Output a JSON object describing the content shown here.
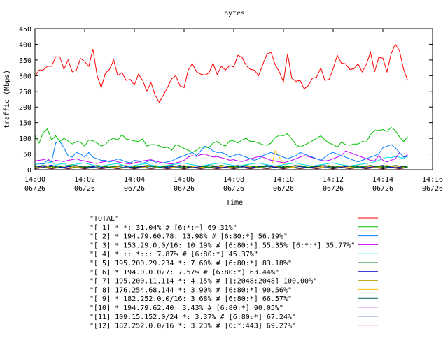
{
  "chart_data": {
    "type": "line",
    "title": "bytes",
    "xlabel": "Time",
    "ylabel": "traffic (Mbps)",
    "ylim": [
      0,
      450
    ],
    "xlim": [
      "14:00",
      "14:16"
    ],
    "grid": false,
    "legend_position": "bottom",
    "yticks": [
      "0",
      "50",
      "100",
      "150",
      "200",
      "250",
      "300",
      "350",
      "400",
      "450"
    ],
    "xticks": [
      {
        "time": "14:00",
        "date": "06/26"
      },
      {
        "time": "14:02",
        "date": "06/26"
      },
      {
        "time": "14:04",
        "date": "06/26"
      },
      {
        "time": "14:06",
        "date": "06/26"
      },
      {
        "time": "14:08",
        "date": "06/26"
      },
      {
        "time": "14:10",
        "date": "06/26"
      },
      {
        "time": "14:12",
        "date": "06/26"
      },
      {
        "time": "14:14",
        "date": "06/26"
      },
      {
        "time": "14:16",
        "date": "06/26"
      }
    ],
    "x_step_seconds": 10,
    "series": [
      {
        "name": "\"TOTAL\"",
        "color": "#ff0000",
        "values": [
          298,
          318,
          318,
          330,
          330,
          360,
          360,
          320,
          350,
          312,
          318,
          355,
          345,
          330,
          385,
          300,
          262,
          308,
          320,
          350,
          300,
          310,
          285,
          288,
          270,
          305,
          285,
          250,
          278,
          238,
          215,
          238,
          262,
          290,
          300,
          268,
          262,
          318,
          338,
          312,
          305,
          302,
          308,
          340,
          304,
          330,
          318,
          332,
          328,
          365,
          358,
          332,
          320,
          318,
          300,
          335,
          368,
          375,
          335,
          312,
          280,
          370,
          292,
          282,
          285,
          258,
          268,
          292,
          295,
          325,
          285,
          288,
          322,
          365,
          340,
          338,
          320,
          322,
          338,
          312,
          335,
          375,
          312,
          358,
          356,
          312,
          370,
          400,
          380,
          320,
          285
        ]
      },
      {
        "name": "\"[ 1] * *: 31.04% # [6:*:*] 69.31%\"",
        "color": "#00c000",
        "values": [
          110,
          85,
          118,
          130,
          95,
          108,
          90,
          100,
          92,
          82,
          90,
          88,
          75,
          95,
          92,
          85,
          75,
          80,
          95,
          100,
          95,
          112,
          98,
          95,
          92,
          90,
          98,
          75,
          80,
          80,
          76,
          70,
          72,
          62,
          80,
          75,
          68,
          62,
          55,
          62,
          72,
          72,
          70,
          85,
          90,
          80,
          75,
          92,
          92,
          85,
          95,
          100,
          90,
          90,
          85,
          80,
          78,
          85,
          102,
          110,
          108,
          115,
          98,
          80,
          72,
          78,
          85,
          92,
          100,
          108,
          95,
          85,
          80,
          72,
          88,
          80,
          78,
          82,
          82,
          90,
          88,
          112,
          125,
          125,
          128,
          122,
          135,
          125,
          105,
          90,
          105
        ]
      },
      {
        "name": "\"[ 2] * 194.79.60.78: 13.98% # [6:80:*] 56.19%\"",
        "color": "#0080ff",
        "values": [
          22,
          20,
          18,
          30,
          25,
          85,
          90,
          70,
          45,
          40,
          55,
          50,
          40,
          55,
          40,
          35,
          30,
          30,
          25,
          28,
          35,
          30,
          25,
          22,
          30,
          28,
          20,
          25,
          30,
          25,
          20,
          22,
          25,
          28,
          35,
          40,
          45,
          50,
          55,
          45,
          60,
          75,
          70,
          60,
          55,
          55,
          50,
          40,
          45,
          50,
          45,
          40,
          35,
          30,
          35,
          45,
          50,
          55,
          50,
          45,
          40,
          35,
          40,
          45,
          55,
          50,
          45,
          40,
          35,
          30,
          40,
          50,
          55,
          50,
          45,
          40,
          35,
          30,
          25,
          30,
          35,
          40,
          45,
          50,
          70,
          75,
          80,
          70,
          55,
          40,
          42
        ]
      },
      {
        "name": "\"[ 3] * 153.29.0.0/16: 10.19% # [6:80:*] 55.35% [6:*:*] 35.77%\"",
        "color": "#c000ff",
        "values": [
          28,
          30,
          32,
          35,
          25,
          30,
          28,
          26,
          30,
          32,
          35,
          30,
          28,
          25,
          22,
          20,
          24,
          26,
          28,
          30,
          25,
          22,
          20,
          18,
          22,
          25,
          28,
          30,
          32,
          28,
          25,
          22,
          20,
          18,
          22,
          25,
          30,
          40,
          45,
          42,
          48,
          50,
          45,
          40,
          42,
          38,
          35,
          30,
          32,
          28,
          26,
          30,
          35,
          38,
          42,
          40,
          35,
          30,
          28,
          25,
          22,
          26,
          30,
          35,
          40,
          45,
          42,
          38,
          35,
          30,
          28,
          30,
          35,
          40,
          45,
          60,
          55,
          50,
          45,
          40,
          35,
          30,
          28,
          45,
          30,
          25,
          30,
          35,
          55,
          40,
          48
        ]
      },
      {
        "name": "\"[ 4] * :: *::: 7.87% # [6:80:*] 45.37%\"",
        "color": "#00e0e0",
        "values": [
          15,
          20,
          18,
          22,
          25,
          15,
          18,
          20,
          12,
          15,
          18,
          20,
          22,
          18,
          15,
          12,
          10,
          14,
          16,
          18,
          20,
          15,
          12,
          10,
          14,
          16,
          18,
          20,
          15,
          12,
          10,
          12,
          14,
          16,
          18,
          20,
          22,
          18,
          16,
          14,
          12,
          14,
          16,
          18,
          20,
          22,
          18,
          16,
          14,
          12,
          14,
          16,
          18,
          20,
          22,
          18,
          16,
          14,
          12,
          14,
          16,
          18,
          20,
          22,
          18,
          16,
          14,
          12,
          14,
          16,
          18,
          20,
          22,
          18,
          16,
          14,
          12,
          14,
          16,
          18,
          20,
          22,
          25,
          30,
          35,
          40,
          38,
          42,
          40,
          35,
          45
        ]
      },
      {
        "name": "\"[ 5] 195.200.29.234 *: 7.60% # [6:80:*] 83.18%\"",
        "color": "#008000",
        "values": [
          10,
          12,
          14,
          12,
          10,
          8,
          10,
          12,
          14,
          16,
          12,
          10,
          8,
          10,
          12,
          14,
          12,
          10,
          8,
          10,
          12,
          14,
          12,
          10,
          8,
          10,
          12,
          14,
          12,
          10,
          8,
          10,
          12,
          14,
          12,
          10,
          8,
          10,
          12,
          14,
          12,
          10,
          8,
          10,
          12,
          14,
          12,
          10,
          8,
          10,
          12,
          14,
          12,
          10,
          8,
          10,
          12,
          14,
          12,
          10,
          8,
          10,
          12,
          14,
          12,
          10,
          8,
          10,
          12,
          14,
          12,
          10,
          8,
          10,
          12,
          14,
          12,
          10,
          8,
          10,
          12,
          14,
          12,
          10,
          8,
          10,
          12,
          14,
          12,
          10,
          8
        ]
      },
      {
        "name": "\"[ 6] * 194.0.0.0/7: 7.57% # [6:80:*] 63.44%\"",
        "color": "#0000c0",
        "values": [
          12,
          10,
          8,
          12,
          15,
          10,
          8,
          6,
          10,
          12,
          14,
          10,
          8,
          6,
          10,
          12,
          8,
          6,
          8,
          10,
          12,
          14,
          10,
          8,
          6,
          8,
          10,
          12,
          14,
          10,
          8,
          6,
          8,
          10,
          12,
          14,
          10,
          8,
          6,
          8,
          10,
          12,
          14,
          10,
          8,
          6,
          8,
          10,
          12,
          14,
          10,
          8,
          6,
          8,
          10,
          12,
          14,
          10,
          8,
          6,
          8,
          10,
          12,
          14,
          10,
          8,
          6,
          8,
          10,
          12,
          14,
          10,
          8,
          6,
          8,
          10,
          12,
          14,
          10,
          8,
          6,
          8,
          10,
          12,
          14,
          10,
          8,
          6,
          8,
          10,
          12
        ]
      },
      {
        "name": "\"[ 7] 195.200.11.114 *: 4.15% # [1:2048:2048] 100.00%\"",
        "color": "#c0a000",
        "values": [
          8,
          10,
          12,
          8,
          6,
          8,
          10,
          12,
          14,
          10,
          8,
          6,
          8,
          10,
          12,
          14,
          10,
          8,
          6,
          8,
          10,
          12,
          14,
          10,
          8,
          6,
          8,
          10,
          12,
          14,
          10,
          8,
          6,
          8,
          10,
          12,
          14,
          10,
          8,
          6,
          8,
          10,
          12,
          14,
          10,
          8,
          6,
          8,
          10,
          12,
          14,
          10,
          8,
          6,
          8,
          10,
          12,
          14,
          10,
          8,
          6,
          8,
          10,
          12,
          14,
          10,
          8,
          6,
          8,
          10,
          12,
          14,
          10,
          8,
          6,
          8,
          10,
          12,
          14,
          10,
          8,
          6,
          8,
          10,
          12,
          14,
          10,
          8,
          6,
          8,
          10
        ]
      },
      {
        "name": "\"[ 8] 176.254.68.144 *: 3.90% # [6:80:*] 90.56%\"",
        "color": "#ffc000",
        "values": [
          5,
          6,
          8,
          10,
          12,
          8,
          6,
          5,
          6,
          8,
          10,
          12,
          8,
          6,
          5,
          6,
          8,
          10,
          12,
          8,
          6,
          5,
          6,
          8,
          10,
          12,
          8,
          6,
          5,
          6,
          8,
          10,
          12,
          8,
          6,
          5,
          6,
          8,
          10,
          12,
          8,
          6,
          5,
          6,
          8,
          10,
          12,
          8,
          6,
          5,
          6,
          8,
          10,
          12,
          8,
          6,
          5,
          6,
          60,
          40,
          20,
          10,
          8,
          6,
          5,
          6,
          8,
          10,
          12,
          8,
          6,
          5,
          6,
          8,
          10,
          12,
          8,
          6,
          5,
          6,
          8,
          10,
          12,
          8,
          6,
          5,
          6,
          8,
          10,
          12,
          8
        ]
      },
      {
        "name": "\"[ 9] * 182.252.0.0/16: 3.68% # [6:80:*] 66.57%\"",
        "color": "#006060",
        "values": [
          10,
          8,
          6,
          8,
          10,
          8,
          6,
          8,
          10,
          8,
          6,
          8,
          10,
          8,
          6,
          8,
          10,
          8,
          6,
          8,
          10,
          8,
          6,
          8,
          10,
          8,
          6,
          8,
          10,
          8,
          6,
          8,
          10,
          8,
          6,
          8,
          10,
          8,
          6,
          8,
          10,
          8,
          6,
          8,
          10,
          8,
          6,
          8,
          10,
          8,
          6,
          8,
          10,
          8,
          6,
          8,
          10,
          8,
          6,
          8,
          10,
          8,
          6,
          8,
          10,
          8,
          6,
          8,
          10,
          8,
          6,
          8,
          10,
          8,
          6,
          8,
          10,
          8,
          6,
          8,
          10,
          8,
          6,
          8,
          10,
          8,
          6,
          8,
          10,
          8,
          6
        ]
      },
      {
        "name": "\"[10] * 194.79.62.40: 3.43% # [6:80:*] 90.05%\"",
        "color": "#c080ff",
        "values": [
          6,
          8,
          10,
          12,
          10,
          8,
          6,
          8,
          10,
          12,
          10,
          8,
          6,
          8,
          10,
          12,
          10,
          8,
          6,
          8,
          10,
          12,
          10,
          8,
          6,
          8,
          10,
          12,
          10,
          8,
          6,
          8,
          10,
          12,
          10,
          8,
          6,
          8,
          10,
          12,
          10,
          8,
          6,
          8,
          10,
          12,
          10,
          8,
          6,
          8,
          10,
          12,
          10,
          8,
          6,
          8,
          10,
          12,
          10,
          8,
          6,
          8,
          10,
          12,
          10,
          8,
          6,
          8,
          10,
          12,
          10,
          8,
          6,
          8,
          10,
          12,
          10,
          8,
          6,
          8,
          10,
          12,
          10,
          8,
          6,
          8,
          10,
          12,
          10,
          8,
          6
        ]
      },
      {
        "name": "\"[11] 109.15.152.0/24 *: 3.37% # [6:80:*] 67.24%\"",
        "color": "#004080",
        "values": [
          4,
          6,
          8,
          6,
          4,
          6,
          8,
          6,
          4,
          6,
          8,
          6,
          4,
          6,
          8,
          6,
          4,
          6,
          8,
          6,
          4,
          6,
          8,
          6,
          4,
          6,
          8,
          6,
          4,
          6,
          8,
          6,
          4,
          6,
          8,
          6,
          4,
          6,
          8,
          6,
          4,
          6,
          8,
          6,
          4,
          6,
          8,
          6,
          4,
          6,
          8,
          6,
          4,
          6,
          8,
          6,
          4,
          6,
          8,
          6,
          4,
          6,
          8,
          6,
          4,
          6,
          8,
          6,
          4,
          6,
          8,
          6,
          4,
          6,
          8,
          6,
          4,
          6,
          8,
          6,
          4,
          6,
          8,
          6,
          4,
          6,
          8,
          6,
          4,
          6,
          8
        ]
      },
      {
        "name": "\"[12] 182.252.0.0/16 *: 3.23% # [6:*:443] 69.27%\"",
        "color": "#c00000",
        "values": [
          3,
          5,
          7,
          5,
          3,
          5,
          7,
          5,
          3,
          5,
          7,
          5,
          3,
          5,
          7,
          5,
          3,
          5,
          7,
          5,
          3,
          5,
          7,
          5,
          3,
          5,
          7,
          5,
          3,
          5,
          7,
          5,
          3,
          5,
          7,
          5,
          3,
          5,
          7,
          5,
          3,
          5,
          7,
          5,
          3,
          5,
          7,
          5,
          3,
          5,
          7,
          5,
          3,
          5,
          7,
          5,
          3,
          5,
          7,
          5,
          3,
          5,
          7,
          5,
          3,
          5,
          7,
          5,
          3,
          5,
          7,
          5,
          3,
          5,
          7,
          5,
          3,
          5,
          7,
          5,
          3,
          5,
          7,
          5,
          3,
          5,
          7,
          5,
          3,
          5,
          7
        ]
      }
    ]
  }
}
